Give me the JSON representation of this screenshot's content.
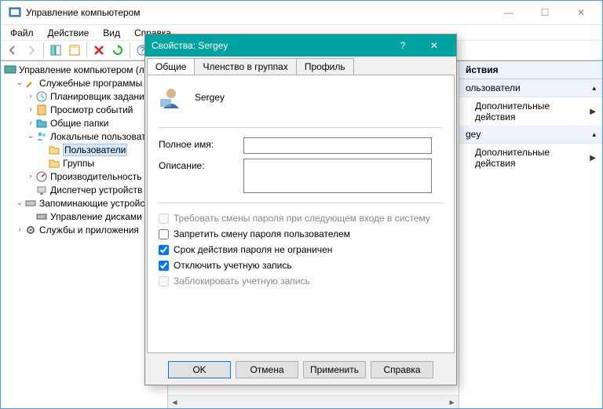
{
  "main": {
    "title": "Управление компьютером",
    "menu": {
      "file": "Файл",
      "action": "Действие",
      "view": "Вид",
      "help": "Справка"
    },
    "win": {
      "min": "—",
      "max": "☐",
      "close": "✕"
    }
  },
  "tree": {
    "root": "Управление компьютером (л",
    "tools": "Служебные программы",
    "scheduler": "Планировщик заданий",
    "events": "Просмотр событий",
    "shared": "Общие папки",
    "localusers": "Локальные пользоват",
    "users": "Пользователи",
    "groups": "Группы",
    "perf": "Производительность",
    "devmgr": "Диспетчер устройств",
    "storage": "Запоминающие устройст",
    "diskmgr": "Управление дисками",
    "services": "Службы и приложения"
  },
  "actions": {
    "header": "йствия",
    "sec1": "ользователи",
    "item1": "Дополнительные действия",
    "sec2": "gey",
    "item2": "Дополнительные действия"
  },
  "dialog": {
    "title": "Свойства: Sergey",
    "help": "?",
    "close": "✕",
    "tabs": {
      "general": "Общие",
      "member": "Членство в группах",
      "profile": "Профиль"
    },
    "username": "Sergey",
    "fullname_label": "Полное имя:",
    "fullname_value": "",
    "desc_label": "Описание:",
    "desc_value": "",
    "chk_mustchange": "Требовать смены пароля при следующем входе в систему",
    "chk_cantchange": "Запретить смену пароля пользователем",
    "chk_neverexpire": "Срок действия пароля не ограничен",
    "chk_disabled": "Отключить учетную запись",
    "chk_locked": "Заблокировать учетную запись",
    "buttons": {
      "ok": "OK",
      "cancel": "Отмена",
      "apply": "Применить",
      "help": "Справка"
    },
    "state": {
      "neverexpire": true,
      "disabled": true,
      "cantchange": false,
      "mustchange": false,
      "locked": false
    }
  }
}
